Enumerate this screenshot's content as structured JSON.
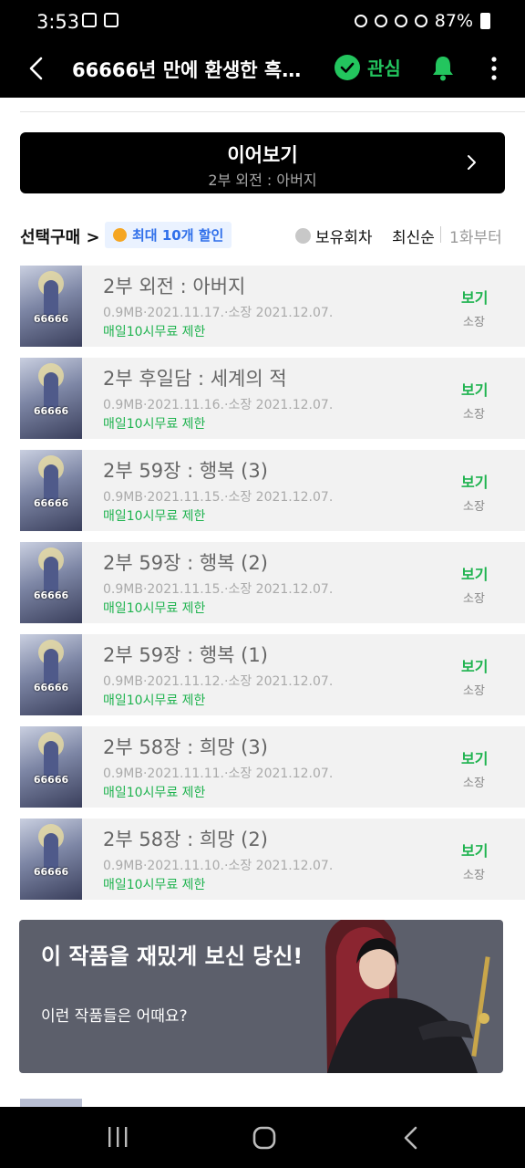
{
  "status": {
    "time": "3:53",
    "battery": "87%"
  },
  "appbar": {
    "title": "66666년 만에 환생한 흑마...",
    "favorite_label": "관심"
  },
  "continue": {
    "label": "이어보기",
    "subtitle": "2부 외전 : 아버지"
  },
  "filter": {
    "select_buy": "선택구매 >",
    "discount_badge": "최대 10개 할인",
    "owned_filter": "보유회차",
    "sort": "최신순",
    "from_first": "1화부터"
  },
  "thumb_text": "66666",
  "episodes": [
    {
      "title": "2부 외전 : 아버지",
      "meta": "0.9MB·2021.11.17.·소장 2021.12.07.",
      "free": "매일10시무료 제한",
      "view": "보기",
      "owned": "소장"
    },
    {
      "title": "2부 후일담 : 세계의 적",
      "meta": "0.9MB·2021.11.16.·소장 2021.12.07.",
      "free": "매일10시무료 제한",
      "view": "보기",
      "owned": "소장"
    },
    {
      "title": "2부 59장 : 행복 (3)",
      "meta": "0.9MB·2021.11.15.·소장 2021.12.07.",
      "free": "매일10시무료 제한",
      "view": "보기",
      "owned": "소장"
    },
    {
      "title": "2부 59장 : 행복 (2)",
      "meta": "0.9MB·2021.11.15.·소장 2021.12.07.",
      "free": "매일10시무료 제한",
      "view": "보기",
      "owned": "소장"
    },
    {
      "title": "2부 59장 : 행복 (1)",
      "meta": "0.9MB·2021.11.12.·소장 2021.12.07.",
      "free": "매일10시무료 제한",
      "view": "보기",
      "owned": "소장"
    },
    {
      "title": "2부 58장 : 희망 (3)",
      "meta": "0.9MB·2021.11.11.·소장 2021.12.07.",
      "free": "매일10시무료 제한",
      "view": "보기",
      "owned": "소장"
    },
    {
      "title": "2부 58장 : 희망 (2)",
      "meta": "0.9MB·2021.11.10.·소장 2021.12.07.",
      "free": "매일10시무료 제한",
      "view": "보기",
      "owned": "소장"
    }
  ],
  "banner": {
    "headline": "이 작품을 재밌게 보신 당신!",
    "sub": "이런 작품들은 어때요?"
  },
  "colors": {
    "accent_green": "#23c55e",
    "free_green": "#1fb34f",
    "badge_blue": "#2f6fea",
    "banner_bg": "#5c5f6b"
  }
}
